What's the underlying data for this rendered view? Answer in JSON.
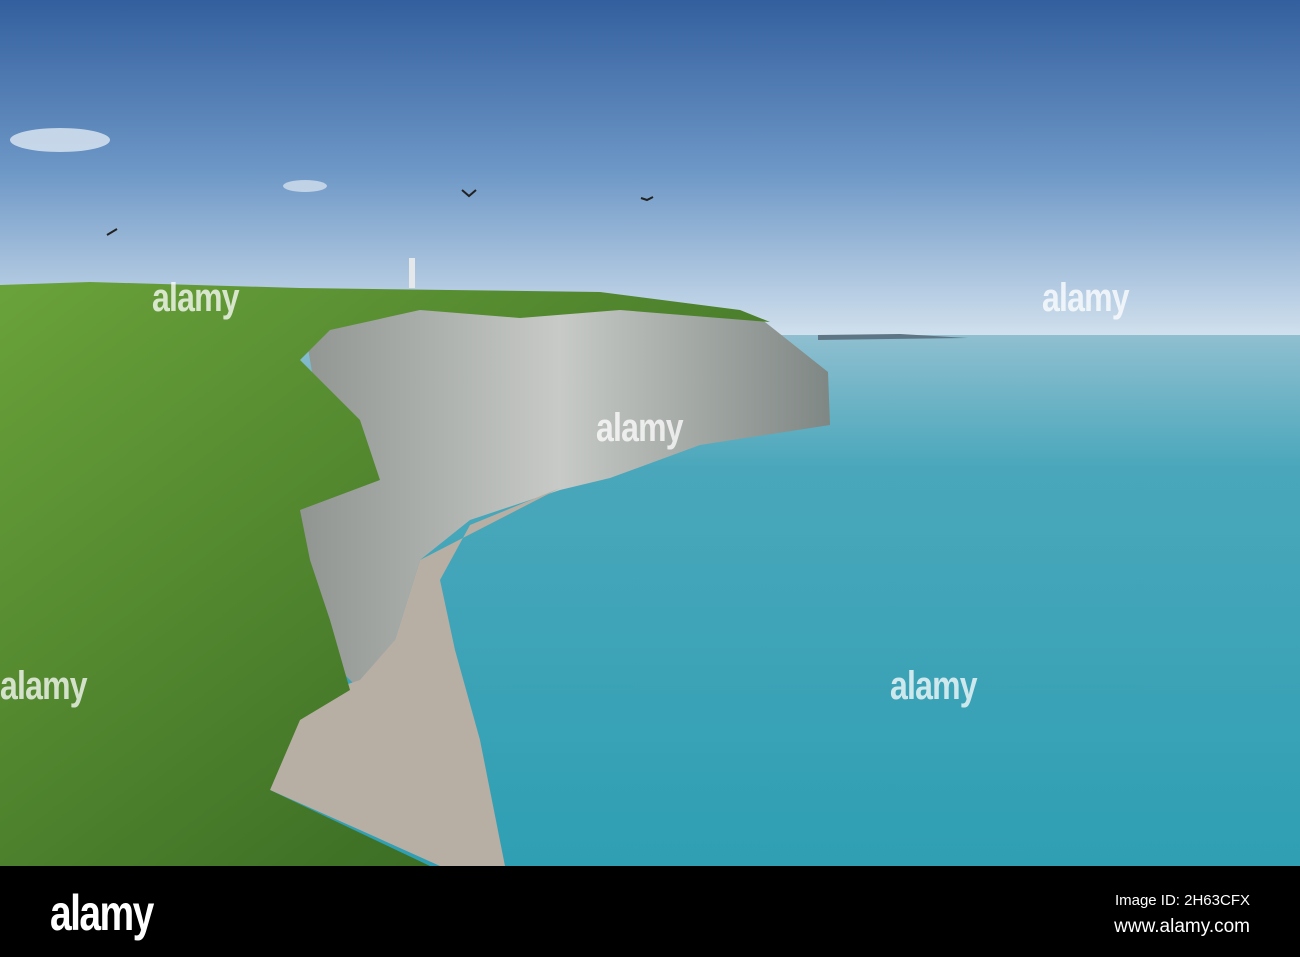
{
  "watermark": {
    "text": "alamy"
  },
  "footer": {
    "logo": "alamy",
    "image_id": "Image ID: 2H63CFX",
    "url": "www.alamy.com"
  },
  "colors": {
    "sky_top": "#3a68a6",
    "sky_horizon": "#cfe0ee",
    "sea": "#3fa4b6",
    "grass": "#4f8a2a",
    "cliff": "#b9bcb8",
    "footer": "#000000"
  }
}
